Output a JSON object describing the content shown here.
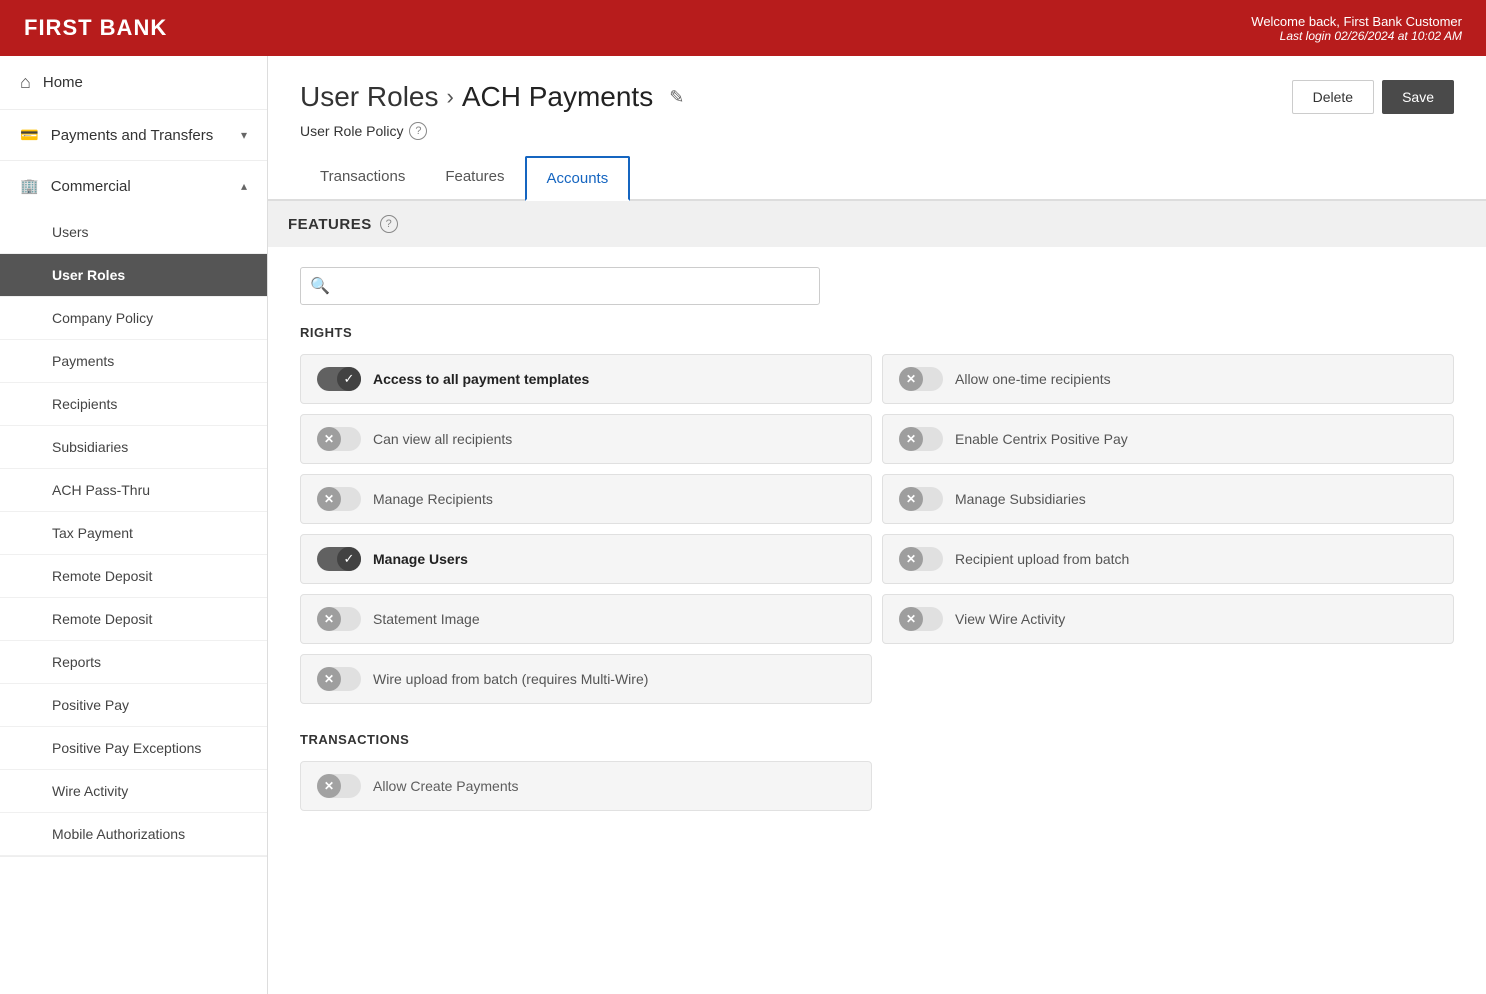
{
  "header": {
    "logo": "FIRST BANK",
    "welcome": "Welcome back, First Bank Customer",
    "last_login": "Last login 02/26/2024 at 10:02 AM"
  },
  "sidebar": {
    "home_label": "Home",
    "payments_label": "Payments and Transfers",
    "commercial_label": "Commercial",
    "sub_items": [
      {
        "label": "Users",
        "active": false
      },
      {
        "label": "User Roles",
        "active": true
      },
      {
        "label": "Company Policy",
        "active": false
      },
      {
        "label": "Payments",
        "active": false
      },
      {
        "label": "Recipients",
        "active": false
      },
      {
        "label": "Subsidiaries",
        "active": false
      },
      {
        "label": "ACH Pass-Thru",
        "active": false
      },
      {
        "label": "Tax Payment",
        "active": false
      },
      {
        "label": "Remote Deposit",
        "active": false
      },
      {
        "label": "Remote Deposit",
        "active": false
      },
      {
        "label": "Reports",
        "active": false
      },
      {
        "label": "Positive Pay",
        "active": false
      },
      {
        "label": "Positive Pay Exceptions",
        "active": false
      },
      {
        "label": "Wire Activity",
        "active": false
      },
      {
        "label": "Mobile Authorizations",
        "active": false
      }
    ]
  },
  "breadcrumb": {
    "parent": "User Roles",
    "current": "ACH Payments"
  },
  "policy_label": "User Role Policy",
  "buttons": {
    "delete": "Delete",
    "save": "Save"
  },
  "tabs": [
    {
      "label": "Transactions",
      "active": false
    },
    {
      "label": "Features",
      "active": false
    },
    {
      "label": "Accounts",
      "active": true
    }
  ],
  "features_section": {
    "title": "FEATURES",
    "search_placeholder": ""
  },
  "rights": {
    "title": "RIGHTS",
    "items": [
      {
        "label": "Access to all payment templates",
        "state": "on",
        "col": 0
      },
      {
        "label": "Allow one-time recipients",
        "state": "off",
        "col": 1
      },
      {
        "label": "Can view all recipients",
        "state": "off",
        "col": 0
      },
      {
        "label": "Enable Centrix Positive Pay",
        "state": "off",
        "col": 1
      },
      {
        "label": "Manage Recipients",
        "state": "off",
        "col": 0
      },
      {
        "label": "Manage Subsidiaries",
        "state": "off",
        "col": 1
      },
      {
        "label": "Manage Users",
        "state": "on",
        "col": 0
      },
      {
        "label": "Recipient upload from batch",
        "state": "off",
        "col": 1
      },
      {
        "label": "Statement Image",
        "state": "off",
        "col": 0
      },
      {
        "label": "View Wire Activity",
        "state": "off",
        "col": 1
      },
      {
        "label": "Wire upload from batch (requires Multi-Wire)",
        "state": "off",
        "col": 0
      }
    ]
  },
  "transactions": {
    "title": "TRANSACTIONS",
    "items": [
      {
        "label": "Allow Create Payments",
        "state": "off"
      }
    ]
  }
}
